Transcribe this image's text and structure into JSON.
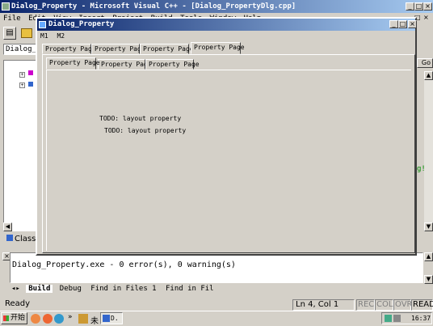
{
  "main_window": {
    "title": "Dialog_Property - Microsoft Visual C++ - [Dialog_PropertyDlg.cpp]",
    "menu": [
      "File",
      "Edit",
      "View",
      "Insert",
      "Project",
      "Build",
      "Tools",
      "Window",
      "Help"
    ],
    "toolbar_combo": "Dialog_Propert",
    "class_tab_label": "Class",
    "go_label": "Go"
  },
  "dialog": {
    "title": "Dialog_Property",
    "menu": [
      "M1",
      "M2"
    ],
    "outer_tabs": [
      "Property Page",
      "Property Page",
      "Property Page",
      "Property Page"
    ],
    "outer_active": 3,
    "inner_tabs": [
      "Property Page",
      "Property Page",
      "Property Page"
    ],
    "inner_active": 0,
    "content_lines": [
      "TODO: layout property",
      "TODO: layout property"
    ]
  },
  "output": {
    "text": "Dialog_Property.exe - 0 error(s), 0 warning(s)",
    "tabs": [
      "Build",
      "Debug",
      "Find in Files 1",
      "Find in Fil"
    ]
  },
  "status": {
    "ready": "Ready",
    "position": "Ln 4, Col 1",
    "indicators": [
      "REC",
      "COL",
      "OVR",
      "READ"
    ]
  },
  "taskbar": {
    "start_label": "开始",
    "task_label": "D.",
    "ime_label": "未",
    "clock": "16:37"
  },
  "colors": {
    "title_active": "#0a246a",
    "title_gradient_end": "#a6caf0",
    "face": "#d4d0c8"
  }
}
